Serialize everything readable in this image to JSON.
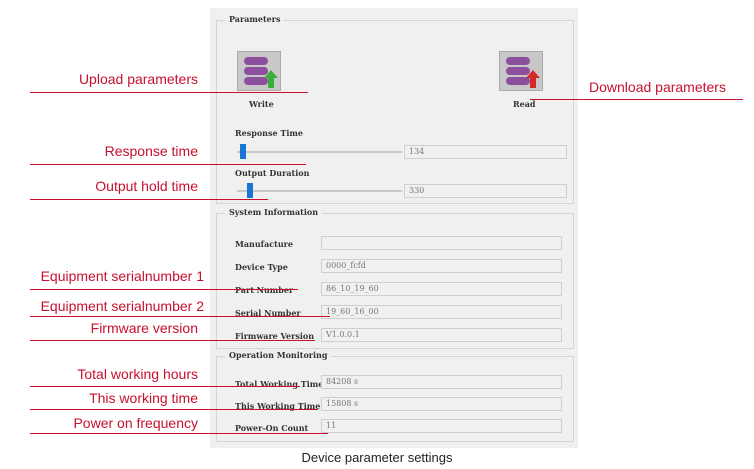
{
  "parameters": {
    "title": "Parameters",
    "write_label": "Write",
    "read_label": "Read",
    "response_time_label": "Response Time",
    "response_time_value": "134",
    "output_duration_label": "Output Duration",
    "output_duration_value": "330"
  },
  "system_information": {
    "title": "System Information",
    "manufacture_label": "Manufacture",
    "manufacture_value": "",
    "device_type_label": "Device Type",
    "device_type_value": "0000_fcfd",
    "part_number_label": "Part Number",
    "part_number_value": "86_10_19_60",
    "serial_number_label": "Serial Number",
    "serial_number_value": "19_60_16_00",
    "firmware_version_label": "Firmware Version",
    "firmware_version_value": "V1.0.0.1"
  },
  "operation_monitoring": {
    "title": "Operation Monitoring",
    "total_working_time_label": "Total Working Time",
    "total_working_time_value": "84208 s",
    "this_working_time_label": "This Working Time",
    "this_working_time_value": "15808 s",
    "power_on_count_label": "Power-On Count",
    "power_on_count_value": "11"
  },
  "annotations": {
    "upload_parameters": "Upload parameters",
    "download_parameters": "Download parameters",
    "response_time": "Response time",
    "output_hold_time": "Output hold time",
    "equipment_serialnumber_1": "Equipment serialnumber 1",
    "equipment_serialnumber_2": "Equipment serialnumber 2",
    "firmware_version": "Firmware version",
    "total_working_hours": "Total working hours",
    "this_working_time": "This working time",
    "power_on_frequency": "Power on frequency"
  },
  "caption": "Device parameter settings",
  "colors": {
    "annotation": "#c8102e",
    "slider_thumb": "#1976d2",
    "icon_bars": "#8b4f9e",
    "arrow_up": "#3cae3c",
    "arrow_down": "#d42a2a"
  },
  "icons": {
    "write": "upload-arrow-icon",
    "read": "download-arrow-icon"
  },
  "sliders": {
    "response_time_fraction": 0.02,
    "output_duration_fraction": 0.06
  }
}
